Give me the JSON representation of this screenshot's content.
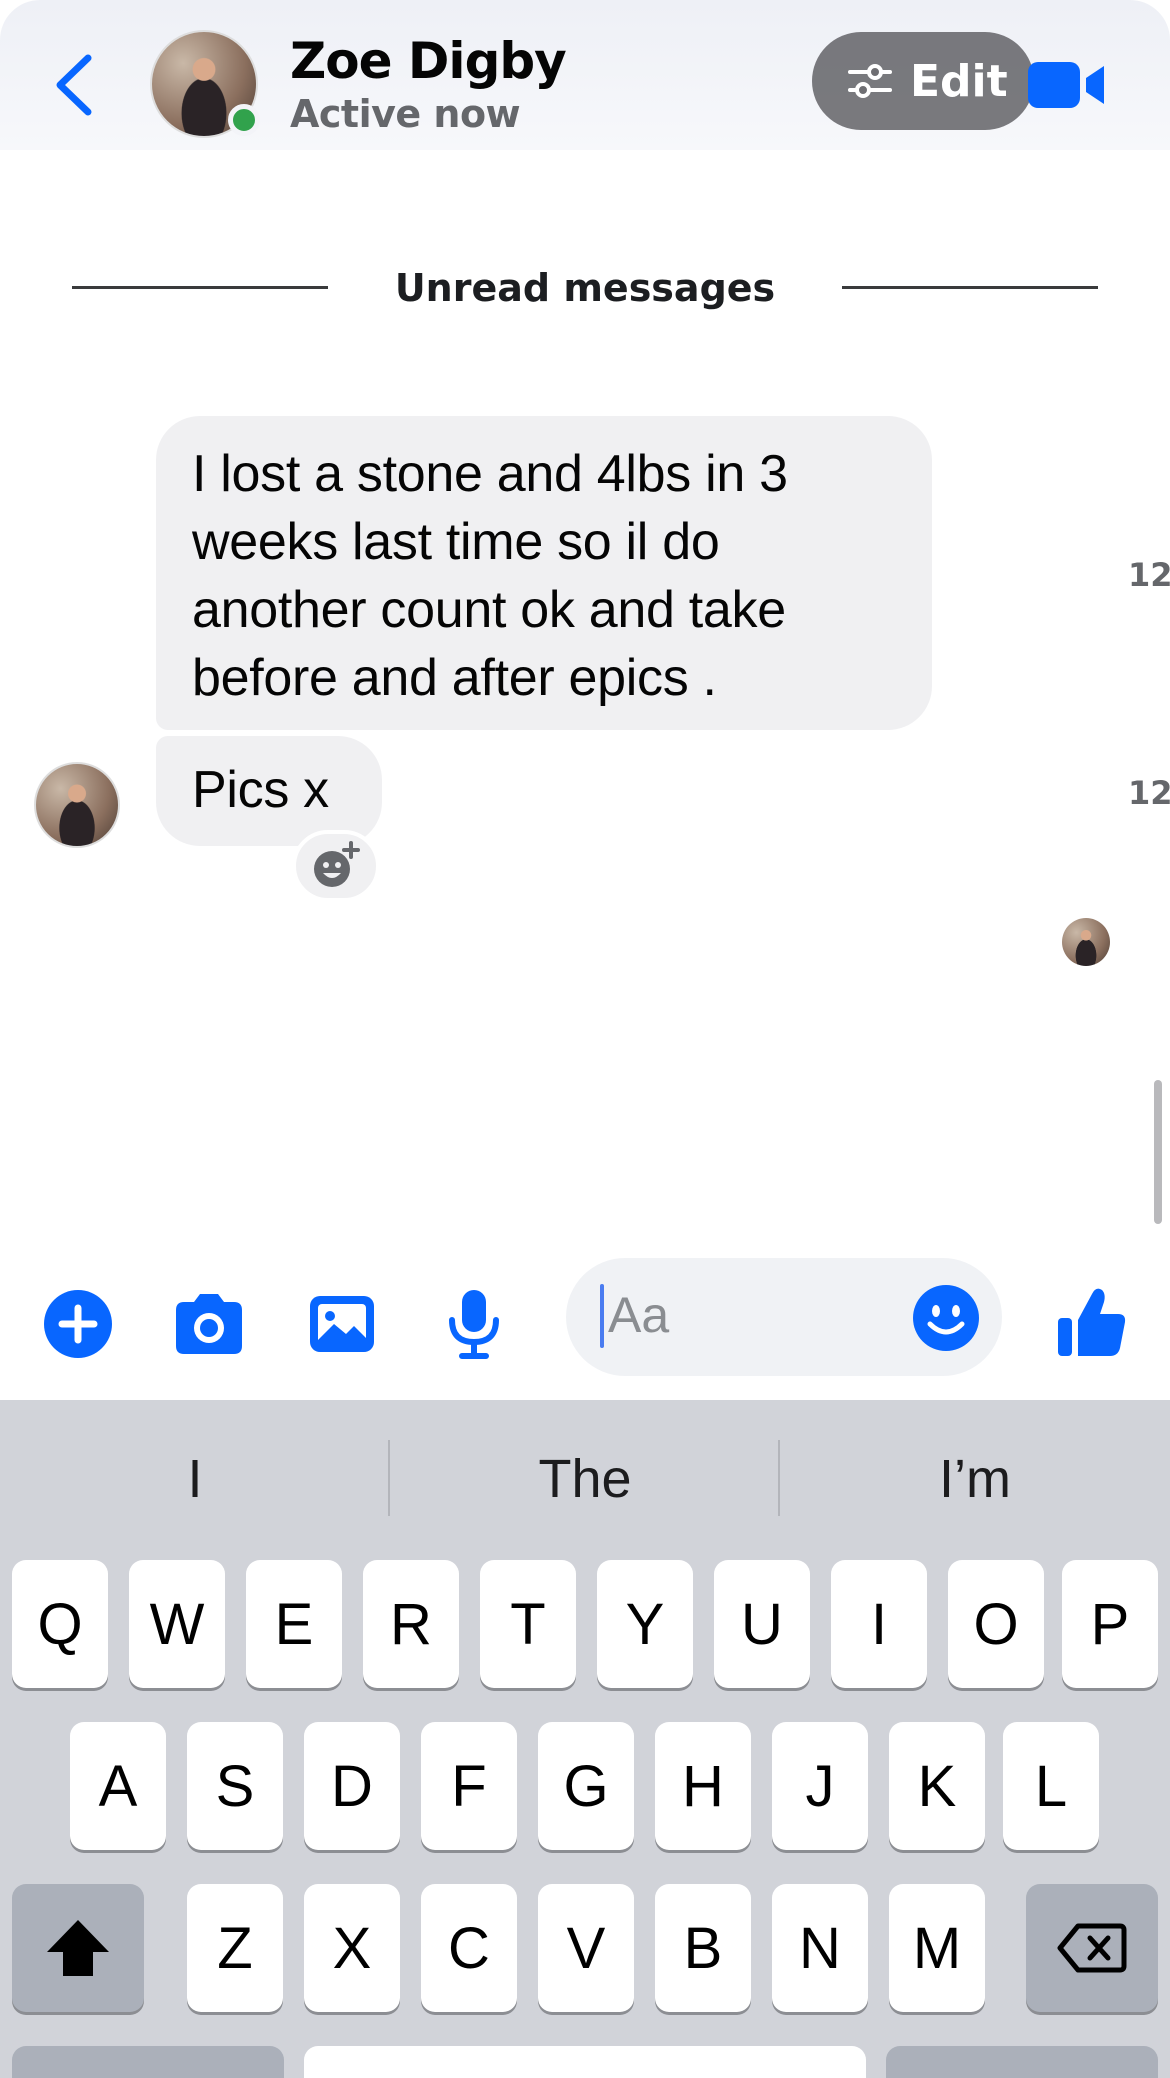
{
  "header": {
    "contact_name": "Zoe Digby",
    "status": "Active now",
    "edit_label": "Edit"
  },
  "divider": {
    "label": "Unread messages"
  },
  "messages": [
    {
      "lines": [
        "I lost a stone and 4lbs in 3",
        "weeks last time so il do",
        "another count ok and take",
        "before and after epics ."
      ],
      "time": "12"
    },
    {
      "lines": [
        "Pics x"
      ],
      "time": "12"
    }
  ],
  "composer": {
    "placeholder": "Aa"
  },
  "keyboard": {
    "suggestions": [
      "I",
      "The",
      "I’m"
    ],
    "row1": [
      "Q",
      "W",
      "E",
      "R",
      "T",
      "Y",
      "U",
      "I",
      "O",
      "P"
    ],
    "row2": [
      "A",
      "S",
      "D",
      "F",
      "G",
      "H",
      "J",
      "K",
      "L"
    ],
    "row3": [
      "Z",
      "X",
      "C",
      "V",
      "B",
      "N",
      "M"
    ]
  },
  "colors": {
    "accent": "#0866ff",
    "online": "#31a24c",
    "bubble_bg": "#f0f0f2",
    "keyboard_bg": "#d1d3d9"
  },
  "icons": [
    "back-chevron-icon",
    "filter-sliders-icon",
    "video-camera-icon",
    "add-reaction-icon",
    "plus-icon",
    "camera-icon",
    "gallery-icon",
    "microphone-icon",
    "smiley-icon",
    "thumbs-up-icon",
    "shift-icon",
    "backspace-icon"
  ]
}
